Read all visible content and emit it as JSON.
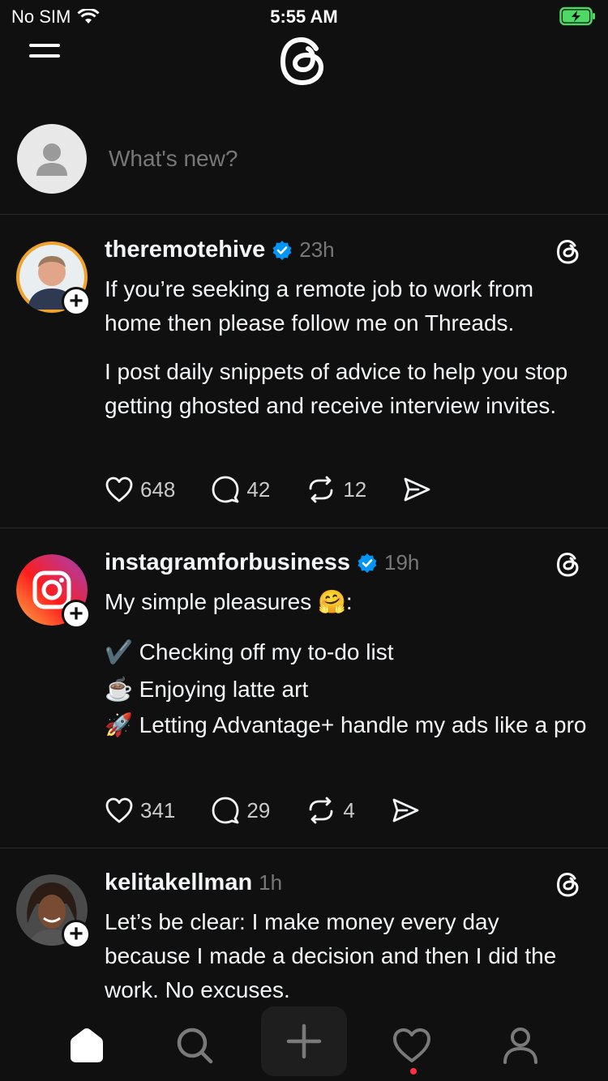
{
  "status_bar": {
    "carrier": "No SIM",
    "time": "5:55 AM"
  },
  "compose": {
    "placeholder": "What's new?"
  },
  "posts": [
    {
      "username": "theremotehive",
      "verified": true,
      "time": "23h",
      "paragraphs": [
        "If you’re seeking a remote job to work from home then please follow me on Threads.",
        "I post daily snippets of advice to help you stop getting ghosted and receive interview invites."
      ],
      "likes": "648",
      "replies": "42",
      "reposts": "12"
    },
    {
      "username": "instagramforbusiness",
      "verified": true,
      "time": "19h",
      "intro": "My simple pleasures 🤗:",
      "list": [
        {
          "emoji": "✔️",
          "text": "Checking off my to-do list"
        },
        {
          "emoji": "☕",
          "text": "Enjoying latte art"
        },
        {
          "emoji": "🚀",
          "text": "Letting Advantage+ handle my ads like a pro"
        }
      ],
      "likes": "341",
      "replies": "29",
      "reposts": "4"
    },
    {
      "username": "kelitakellman",
      "verified": false,
      "time": "1h",
      "paragraphs": [
        "Let’s be clear: I make money every day because I made a decision and then I did the work. No excuses."
      ]
    }
  ],
  "colors": {
    "background": "#101010",
    "verified": "#0095f6",
    "notification_dot": "#ff3040"
  },
  "icons": [
    "menu-icon",
    "threads-logo-icon",
    "heart-icon",
    "comment-icon",
    "repost-icon",
    "share-icon",
    "home-icon",
    "search-icon",
    "new-post-icon",
    "activity-icon",
    "profile-icon"
  ]
}
